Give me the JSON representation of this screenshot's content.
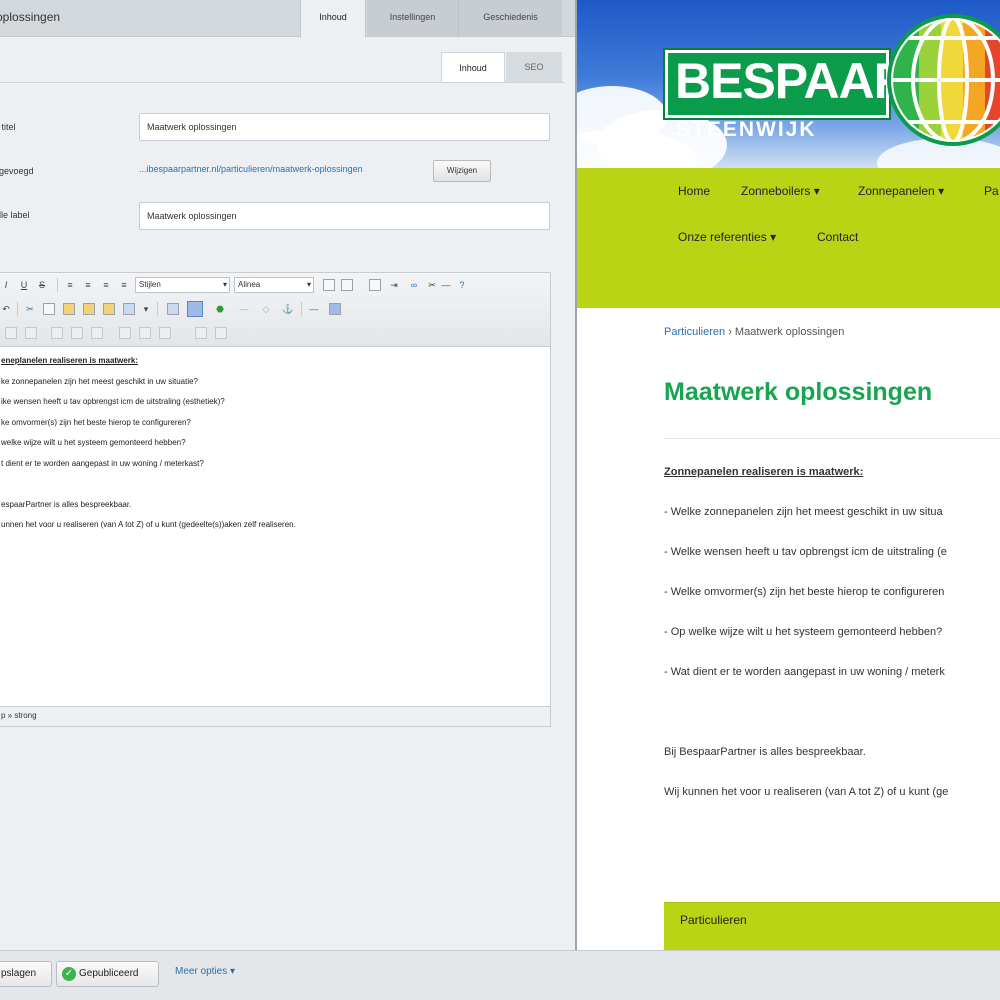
{
  "cms": {
    "doc_title": "oplossingen",
    "tabs": [
      "Inhoud",
      "Instellingen",
      "Geschiedenis"
    ],
    "subtabs": [
      "Inhoud",
      "SEO"
    ],
    "fields": {
      "title_label": "e titel",
      "title_value": "Maatwerk oplossingen",
      "url_label": "egevoegd",
      "url_value": "...ibespaarpartner.nl/particulieren/maatwerk-oplossingen",
      "change_button": "Wijzigen",
      "menu_label": "elle label",
      "menu_value": "Maatwerk oplossingen",
      "body_label": "t"
    },
    "toolbar": {
      "style_select": "Stijlen",
      "block_select": "Alinea"
    },
    "editor_lines": [
      "eneplanelen realiseren is maatwerk:",
      "ke zonnepanelen zijn het meest geschikt in uw situatie?",
      "ike wensen heeft u tav opbrengst icm de uitstraling (esthetiek)?",
      "ke omvormer(s) zijn het beste hierop te configureren?",
      "welke wijze wilt u het systeem gemonteerd hebben?",
      "t dient er te worden aangepast in uw woning / meterkast?",
      "",
      "espaarPartner is alles bespreekbaar.",
      "unnen het voor u realiseren (van A tot Z) of u kunt (gedeelte(s))aken zelf realiseren."
    ],
    "status_path": "p » strong",
    "bottom": {
      "save_button": "pslagen",
      "publish_button": "Gepubliceerd",
      "more_options": "Meer opties"
    }
  },
  "site": {
    "logo_text": "BESPAAR",
    "logo_sub": "STEENWIJK",
    "nav": [
      "Home",
      "Zonneboilers",
      "Zonnepanelen",
      "Pa",
      "Onze referenties",
      "Contact"
    ],
    "breadcrumb_link": "Particulieren",
    "breadcrumb_sep": " › ",
    "breadcrumb_current": "Maatwerk oplossingen",
    "heading": "Maatwerk oplossingen",
    "paragraphs": [
      "Zonnepanelen realiseren is maatwerk:",
      "- Welke zonnepanelen zijn het meest geschikt in uw situa",
      "- Welke wensen heeft u tav opbrengst icm de uitstraling (e",
      "- Welke omvormer(s) zijn het beste hierop te configureren",
      "- Op welke wijze wilt u het systeem gemonteerd hebben?",
      "- Wat dient er te worden aangepast in uw woning / meterk",
      "Bij BespaarPartner is alles bespreekbaar.",
      "Wij kunnen het voor u realiseren (van A tot Z) of u kunt (ge"
    ],
    "sidebar_title": "Particulieren"
  },
  "colors": {
    "site_green": "#18a552",
    "nav_lime": "#b8d414",
    "link_blue": "#2a6fb0",
    "publish_green": "#3bb54a"
  }
}
